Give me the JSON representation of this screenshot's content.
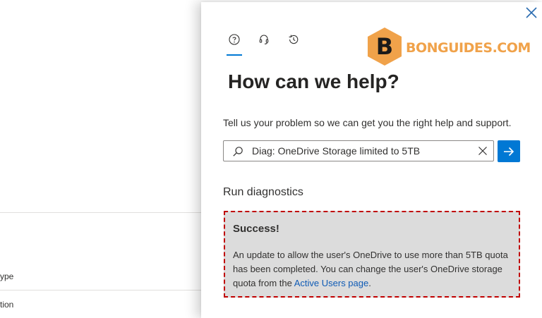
{
  "background": {
    "field_labels": [
      "ype",
      "tion"
    ]
  },
  "panel": {
    "close_icon": "close-icon",
    "tabs": [
      {
        "icon": "help-circle-icon",
        "selected": true
      },
      {
        "icon": "headset-icon",
        "selected": false
      },
      {
        "icon": "history-icon",
        "selected": false
      }
    ],
    "logo": {
      "letter": "B",
      "text": "BONGUIDES.COM"
    },
    "title": "How can we help?",
    "description": "Tell us your problem so we can get you the right help and support.",
    "search": {
      "value": "Diag: OneDrive Storage limited to 5TB",
      "icon": "search-icon",
      "clear_icon": "clear-icon",
      "submit_icon": "arrow-right-icon"
    },
    "diagnostics": {
      "heading": "Run diagnostics",
      "result_title": "Success!",
      "result_text": "An update to allow the user's OneDrive to use more than 5TB quota has been completed. You can change the user's OneDrive storage quota from the",
      "link_text": "Active Users page",
      "result_suffix": "."
    }
  },
  "colors": {
    "accent": "#0078d4",
    "logo_orange": "#f0a24a",
    "result_border": "#c00000",
    "result_background": "#dcdcdc",
    "link": "#0f5bb5"
  }
}
